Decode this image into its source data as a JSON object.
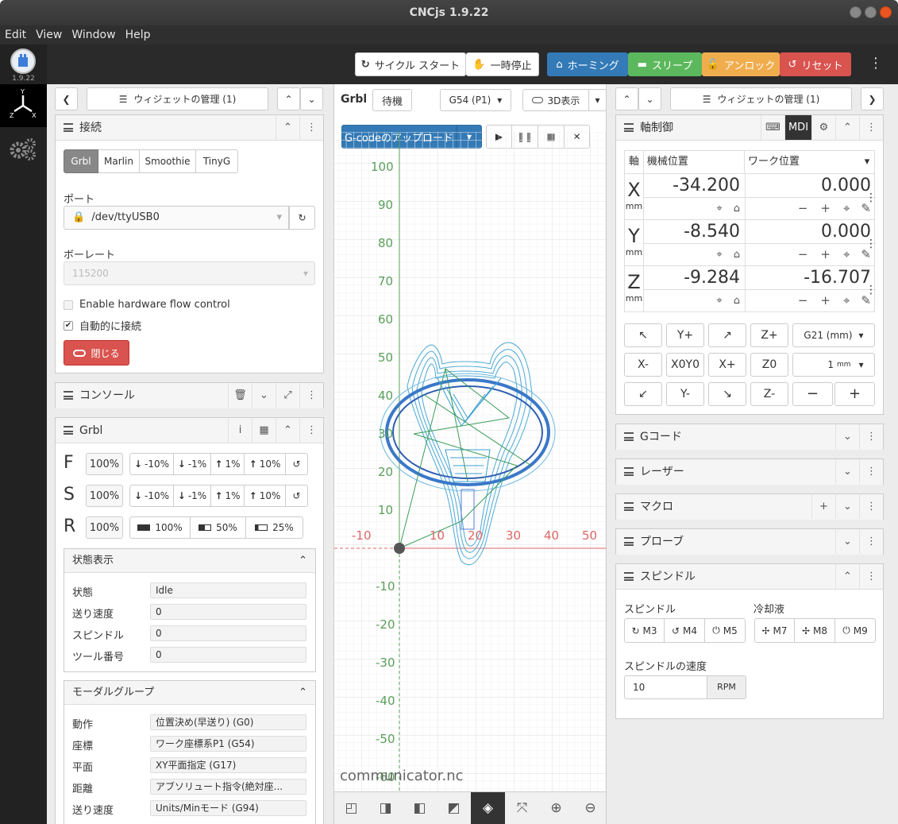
{
  "window": {
    "title": "CNCjs 1.9.22"
  },
  "menu": [
    "Edit",
    "View",
    "Window",
    "Help"
  ],
  "sidebar": {
    "version": "1.9.22"
  },
  "navbar": {
    "cycle_start": "サイクル スタート",
    "feedhold": "一時停止",
    "homing": "ホーミング",
    "sleep": "スリープ",
    "unlock": "アンロック",
    "reset": "リセット",
    "colors": {
      "homing": "#337ab7",
      "sleep": "#5cb85c",
      "unlock": "#f0ad4e",
      "reset": "#d9534f"
    }
  },
  "left": {
    "manage_widgets": "ウィジェットの管理 (1)",
    "connection": {
      "title": "接続",
      "tabs": [
        "Grbl",
        "Marlin",
        "Smoothie",
        "TinyG"
      ],
      "port_label": "ポート",
      "port_value": "/dev/ttyUSB0",
      "baud_label": "ボーレート",
      "baud_value": "115200",
      "flow_control": "Enable hardware flow control",
      "auto_connect": "自動的に接続",
      "close_button": "閉じる"
    },
    "console": {
      "title": "コンソール"
    },
    "grbl": {
      "title": "Grbl",
      "overrides": [
        {
          "letter": "F",
          "value": "100%",
          "buttons": [
            "-10%",
            "-1%",
            "1%",
            "10%"
          ]
        },
        {
          "letter": "S",
          "value": "100%",
          "buttons": [
            "-10%",
            "-1%",
            "1%",
            "10%"
          ]
        }
      ],
      "rapid": {
        "letter": "R",
        "value": "100%",
        "buttons": [
          "100%",
          "50%",
          "25%"
        ]
      },
      "status_title": "状態表示",
      "status_rows": [
        {
          "label": "状態",
          "value": "Idle"
        },
        {
          "label": "送り速度",
          "value": "0"
        },
        {
          "label": "スピンドル",
          "value": "0"
        },
        {
          "label": "ツール番号",
          "value": "0"
        }
      ],
      "modal_title": "モーダルグループ",
      "modal_rows": [
        {
          "label": "動作",
          "value": "位置決め(早送り) (G0)"
        },
        {
          "label": "座標",
          "value": "ワーク座標系P1 (G54)"
        },
        {
          "label": "平面",
          "value": "XY平面指定 (G17)"
        },
        {
          "label": "距離",
          "value": "アブソリュート指令(絶対座..."
        },
        {
          "label": "送り速度",
          "value": "Units/Minモード (G94)"
        }
      ]
    }
  },
  "center": {
    "controller": "Grbl",
    "state": "待機",
    "wcs": "G54 (P1)",
    "view_3d": "3D表示",
    "upload": "G-codeのアップロード",
    "filename": "communicator.nc",
    "y_ticks": [
      "100",
      "90",
      "80",
      "70",
      "60",
      "50",
      "40",
      "30",
      "20",
      "10",
      "-10",
      "-20",
      "-30",
      "-40",
      "-50",
      "-60"
    ],
    "x_ticks": [
      "-10",
      "10",
      "20",
      "30",
      "40",
      "50"
    ]
  },
  "right": {
    "manage_widgets": "ウィジェットの管理 (1)",
    "axes": {
      "title": "軸制御",
      "mdi": "MDI",
      "col_axis": "軸",
      "col_machine": "機械位置",
      "col_work": "ワーク位置",
      "unit": "mm",
      "rows": [
        {
          "axis": "X",
          "machine": "-34.200",
          "work": "0.000"
        },
        {
          "axis": "Y",
          "machine": "-8.540",
          "work": "0.000"
        },
        {
          "axis": "Z",
          "machine": "-9.284",
          "work": "-16.707"
        }
      ],
      "jog_labels": [
        "Y+",
        "Z+",
        "X-",
        "X0Y0",
        "X+",
        "Z0",
        "Y-",
        "Z-"
      ],
      "units_select": "G21 (mm)",
      "step_value": "1",
      "step_unit": "mm"
    },
    "collapsed": [
      "Gコード",
      "レーザー",
      "マクロ",
      "プローブ"
    ],
    "spindle": {
      "title": "スピンドル",
      "spindle_label": "スピンドル",
      "coolant_label": "冷却液",
      "spindle_buttons": [
        "M3",
        "M4",
        "M5"
      ],
      "coolant_buttons": [
        "M7",
        "M8",
        "M9"
      ],
      "speed_label": "スピンドルの速度",
      "speed_value": "10",
      "speed_unit": "RPM"
    }
  }
}
